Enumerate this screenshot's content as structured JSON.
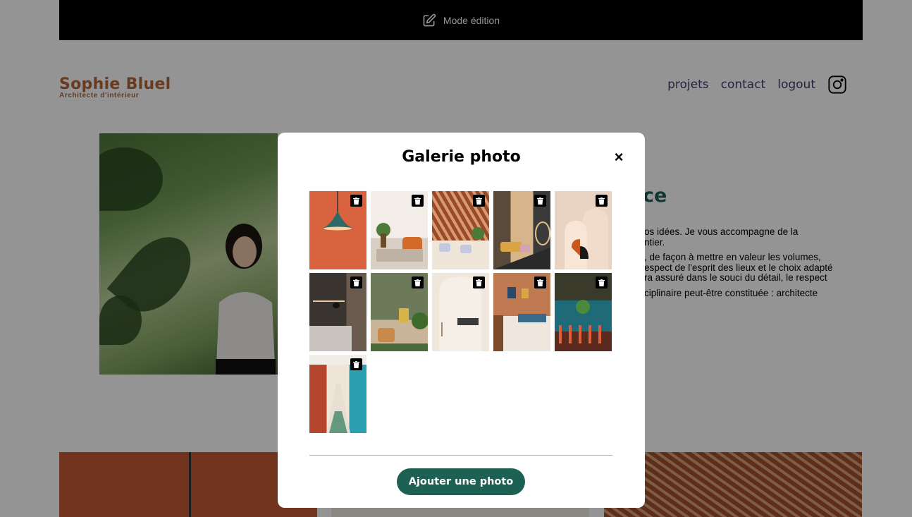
{
  "edit_bar": {
    "label": "Mode édition",
    "icon": "edit-icon"
  },
  "brand": {
    "name": "Sophie Bluel",
    "subtitle": "Architecte d'intérieur",
    "color": "#B1663C"
  },
  "nav": {
    "items": [
      {
        "label": "projets"
      },
      {
        "label": "contact"
      },
      {
        "label": "logout"
      }
    ],
    "social_icon": "instagram-icon"
  },
  "intro": {
    "title_fragment": "ce",
    "paragraphs": [
      "os idées. Je vous accompagne de la\nntier.",
      ", de façon à mettre en valeur les volumes,\nespect de l'esprit des lieux et le choix adapté\nra assuré dans le souci du détail, le respect",
      "ciplinaire peut-être constituée : architecte"
    ]
  },
  "modal": {
    "title": "Galerie photo",
    "close_label": "×",
    "add_button_label": "Ajouter une photo",
    "accent_color": "#1D6154",
    "gallery": [
      {
        "subject": "orange wall pendant lamp"
      },
      {
        "subject": "living room with plants"
      },
      {
        "subject": "restaurant with wooden roof"
      },
      {
        "subject": "room with hanging chair"
      },
      {
        "subject": "arched beige shapes"
      },
      {
        "subject": "dark kitchen with lamp"
      },
      {
        "subject": "green room with armchair"
      },
      {
        "subject": "white arched corridor"
      },
      {
        "subject": "terracotta bedroom"
      },
      {
        "subject": "bar with teal counter"
      },
      {
        "subject": "long restaurant hall"
      }
    ]
  }
}
